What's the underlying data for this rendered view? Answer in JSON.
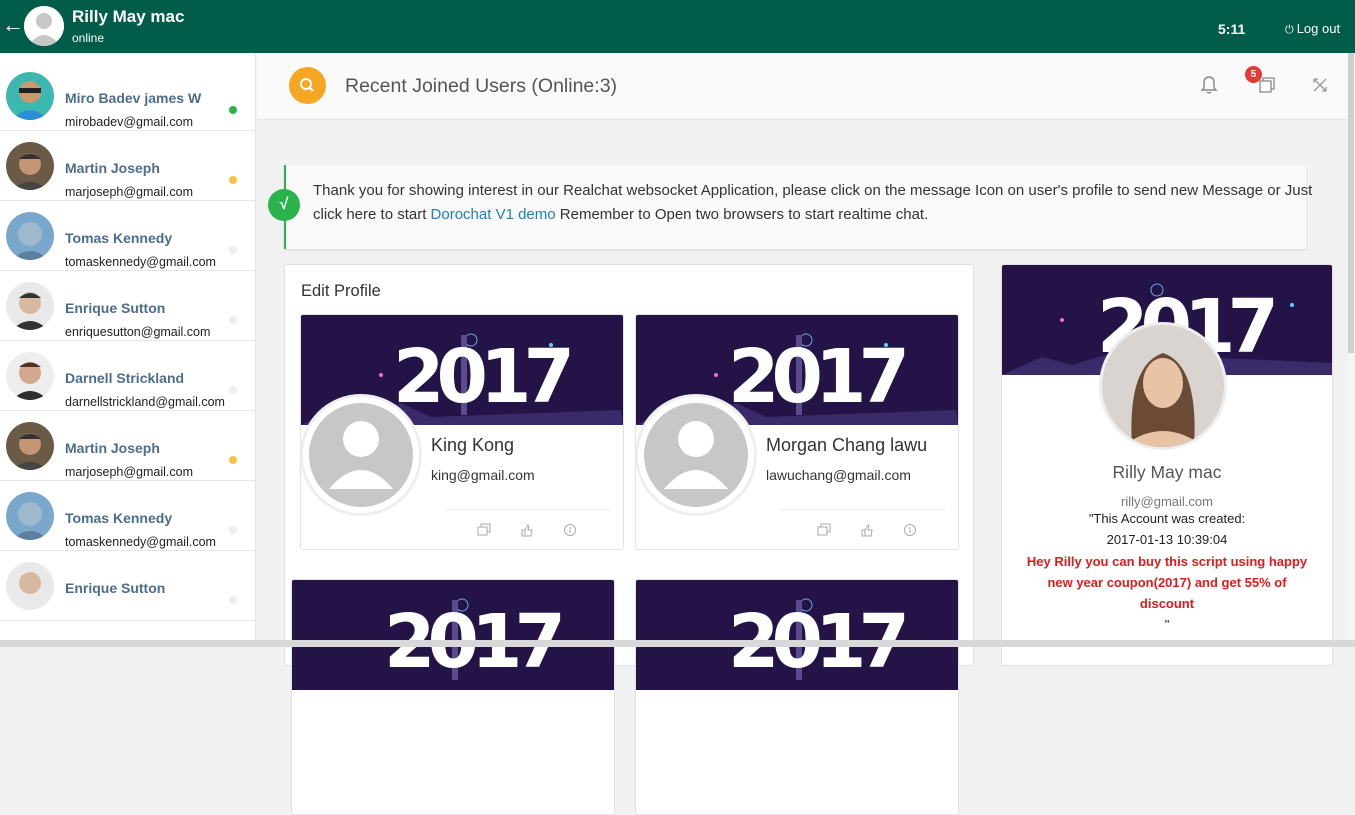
{
  "header": {
    "user_name": "Rilly May mac",
    "user_status": "online",
    "time": "5:11",
    "logout_label": "Log out",
    "bg_color": "#025c4a"
  },
  "sidebar": {
    "users": [
      {
        "name": "Miro Badev james W",
        "email": "mirobadev@gmail.com",
        "status_color": "#2bb34b"
      },
      {
        "name": "Martin Joseph",
        "email": "marjoseph@gmail.com",
        "status_color": "#f5c542"
      },
      {
        "name": "Tomas Kennedy",
        "email": "tomaskennedy@gmail.com",
        "status_color": "#eeeeee"
      },
      {
        "name": "Enrique Sutton",
        "email": "enriquesutton@gmail.com",
        "status_color": "#eeeeee"
      },
      {
        "name": "Darnell Strickland",
        "email": "darnellstrickland@gmail.com",
        "status_color": "#eeeeee"
      },
      {
        "name": "Martin Joseph",
        "email": "marjoseph@gmail.com",
        "status_color": "#f5c542"
      },
      {
        "name": "Tomas Kennedy",
        "email": "tomaskennedy@gmail.com",
        "status_color": "#eeeeee"
      },
      {
        "name": "Enrique Sutton",
        "email": "",
        "status_color": "#eeeeee"
      }
    ]
  },
  "page": {
    "title": "Recent Joined Users (Online:3)",
    "notification_count": "5"
  },
  "alert": {
    "text_before": "Thank you for showing interest in our Realchat websocket Application, please click on the message Icon on user's profile to send new Message or Just click here to start ",
    "link_text": "Dorochat V1 demo",
    "text_after": " Remember to Open two browsers to start realtime chat."
  },
  "edit_profile": {
    "title": "Edit Profile",
    "banner_text": "2017",
    "cards": [
      {
        "name": "King Kong",
        "email": "king@gmail.com"
      },
      {
        "name": "Morgan Chang lawu",
        "email": "lawuchang@gmail.com"
      }
    ]
  },
  "profile": {
    "name": "Rilly   May mac",
    "email": "rilly@gmail.com",
    "created_label": "\"This Account was created:",
    "created_date": "2017-01-13 10:39:04",
    "promo": "Hey Rilly you can buy this script using happy new year coupon(2017) and get 55% of discount",
    "quote_end": "\""
  }
}
